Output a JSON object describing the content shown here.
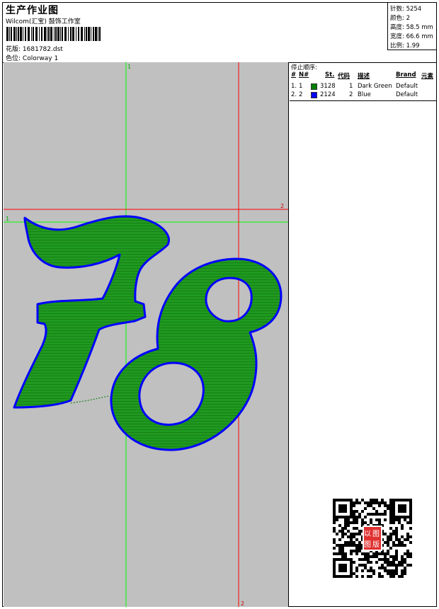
{
  "header": {
    "title": "生产作业图",
    "company": "Wilcom(汇宝) 鼓饰工作室",
    "design_label": "花版:",
    "design_file": "1681782.dst",
    "colorway_label": "色位:",
    "colorway": "Colorway 1"
  },
  "stats": [
    {
      "label": "针数:",
      "value": "5254"
    },
    {
      "label": "颜色:",
      "value": "2"
    },
    {
      "label": "高度:",
      "value": "58.5 mm"
    },
    {
      "label": "宽度:",
      "value": "66.6 mm"
    },
    {
      "label": "比例:",
      "value": "1.99"
    }
  ],
  "stop_sequence": {
    "caption": "停止顺序:",
    "columns": [
      "#",
      "N#",
      "St.",
      "代码",
      "描述",
      "Brand",
      "元素"
    ],
    "rows": [
      {
        "n": "1.",
        "needle": "1",
        "st": "3128",
        "code": "1",
        "desc": "Dark Green",
        "brand": "Default",
        "color": "#008000"
      },
      {
        "n": "2.",
        "needle": "2",
        "st": "2124",
        "code": "2",
        "desc": "Blue",
        "brand": "Default",
        "color": "#0000ff"
      }
    ]
  },
  "guides": {
    "green_v_label": "1",
    "green_h_label": "1",
    "red_h_label": "2",
    "red_v_label": "2"
  },
  "qr": {
    "badge_text": [
      "以",
      "图",
      "图",
      "版"
    ]
  },
  "colors": {
    "fill": "#1f9a1f",
    "outline": "#0000ff",
    "canvas": "#c0c0c0",
    "guide_green": "#00ff00",
    "guide_red": "#ff0000"
  }
}
